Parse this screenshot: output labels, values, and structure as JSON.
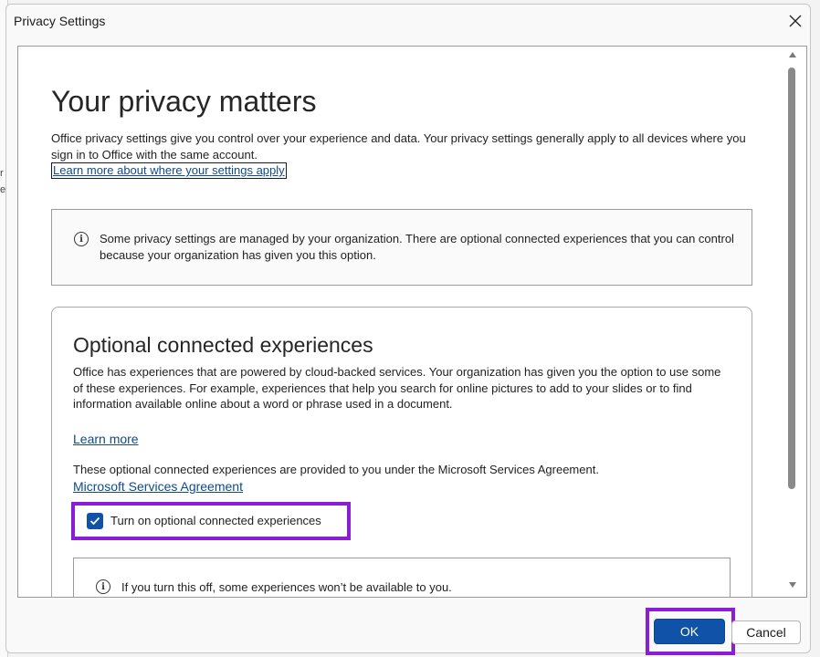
{
  "window": {
    "title": "Privacy Settings"
  },
  "background_fragments": [
    "r",
    "e"
  ],
  "header": {
    "title": "Your privacy matters",
    "description": "Office privacy settings give you control over your experience and data. Your privacy settings generally apply to all devices where you sign in to Office with the same account.",
    "link": "Learn more about where your settings apply"
  },
  "managed_notice": "Some privacy settings are managed by your organization. There are optional connected experiences that you can control because your organization has given you this option.",
  "optional_section": {
    "title": "Optional connected experiences",
    "description": "Office has experiences that are powered by cloud-backed services. Your organization has given you the option to use some of these experiences. For example, experiences that help you search for online pictures to add to your slides or to find information available online about a word or phrase used in a document.",
    "learn_more": "Learn more",
    "agreement_text": "These optional connected experiences are provided to you under the Microsoft Services Agreement.",
    "agreement_link": "Microsoft Services Agreement",
    "checkbox_label": "Turn on optional connected experiences",
    "checkbox_checked": true,
    "turn_off_notice": "If you turn this off, some experiences won’t be available to you."
  },
  "buttons": {
    "ok": "OK",
    "cancel": "Cancel"
  },
  "colors": {
    "accent": "#0f52a8",
    "highlight": "#8a1ed6",
    "link": "#0f4a8a"
  }
}
